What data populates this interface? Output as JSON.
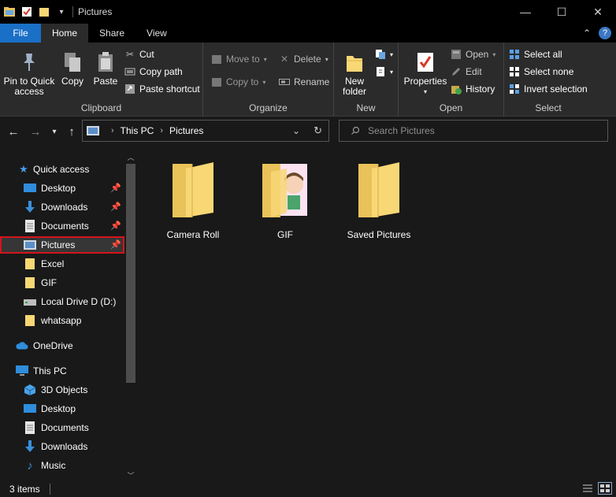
{
  "window": {
    "title": "Pictures",
    "controls": {
      "minimize": "—",
      "maximize": "☐",
      "close": "✕"
    }
  },
  "ribbon_tabs": [
    {
      "label": "File"
    },
    {
      "label": "Home"
    },
    {
      "label": "Share"
    },
    {
      "label": "View"
    }
  ],
  "ribbon": {
    "clipboard": {
      "label": "Clipboard",
      "pin_quick_access": "Pin to Quick access",
      "copy": "Copy",
      "paste": "Paste",
      "cut": "Cut",
      "copy_path": "Copy path",
      "paste_shortcut": "Paste shortcut"
    },
    "organize": {
      "label": "Organize",
      "move_to": "Move to",
      "copy_to": "Copy to",
      "delete": "Delete",
      "rename": "Rename"
    },
    "new": {
      "label": "New",
      "new_folder": "New folder"
    },
    "open": {
      "label": "Open",
      "properties": "Properties",
      "open": "Open",
      "edit": "Edit",
      "history": "History"
    },
    "select": {
      "label": "Select",
      "select_all": "Select all",
      "select_none": "Select none",
      "invert_selection": "Invert selection"
    }
  },
  "address": {
    "crumbs": [
      "This PC",
      "Pictures"
    ],
    "search_placeholder": "Search Pictures"
  },
  "nav_pane": {
    "items": [
      {
        "label": "Quick access",
        "icon": "star-icon"
      },
      {
        "label": "Desktop",
        "icon": "desktop-icon",
        "pinned": true
      },
      {
        "label": "Downloads",
        "icon": "download-icon",
        "pinned": true
      },
      {
        "label": "Documents",
        "icon": "document-icon",
        "pinned": true
      },
      {
        "label": "Pictures",
        "icon": "pictures-icon",
        "pinned": true,
        "selected": true
      },
      {
        "label": "Excel",
        "icon": "folder-icon"
      },
      {
        "label": "GIF",
        "icon": "folder-icon"
      },
      {
        "label": "Local Drive D (D:)",
        "icon": "drive-icon"
      },
      {
        "label": "whatsapp",
        "icon": "folder-icon"
      },
      {
        "label": "OneDrive",
        "icon": "cloud-icon"
      },
      {
        "label": "This PC",
        "icon": "computer-icon"
      },
      {
        "label": "3D Objects",
        "icon": "cube-icon"
      },
      {
        "label": "Desktop",
        "icon": "desktop-icon"
      },
      {
        "label": "Documents",
        "icon": "document-icon"
      },
      {
        "label": "Downloads",
        "icon": "download-icon"
      },
      {
        "label": "Music",
        "icon": "music-icon"
      }
    ]
  },
  "content": {
    "items": [
      {
        "label": "Camera Roll",
        "icon": "folder-icon"
      },
      {
        "label": "GIF",
        "icon": "folder-with-pictures-icon"
      },
      {
        "label": "Saved Pictures",
        "icon": "folder-icon"
      }
    ]
  },
  "status": {
    "item_count": "3 items"
  },
  "colors": {
    "accent": "#1a6fc6",
    "selection_outline": "#d4141b",
    "folder_yellow": "#f8d775"
  }
}
